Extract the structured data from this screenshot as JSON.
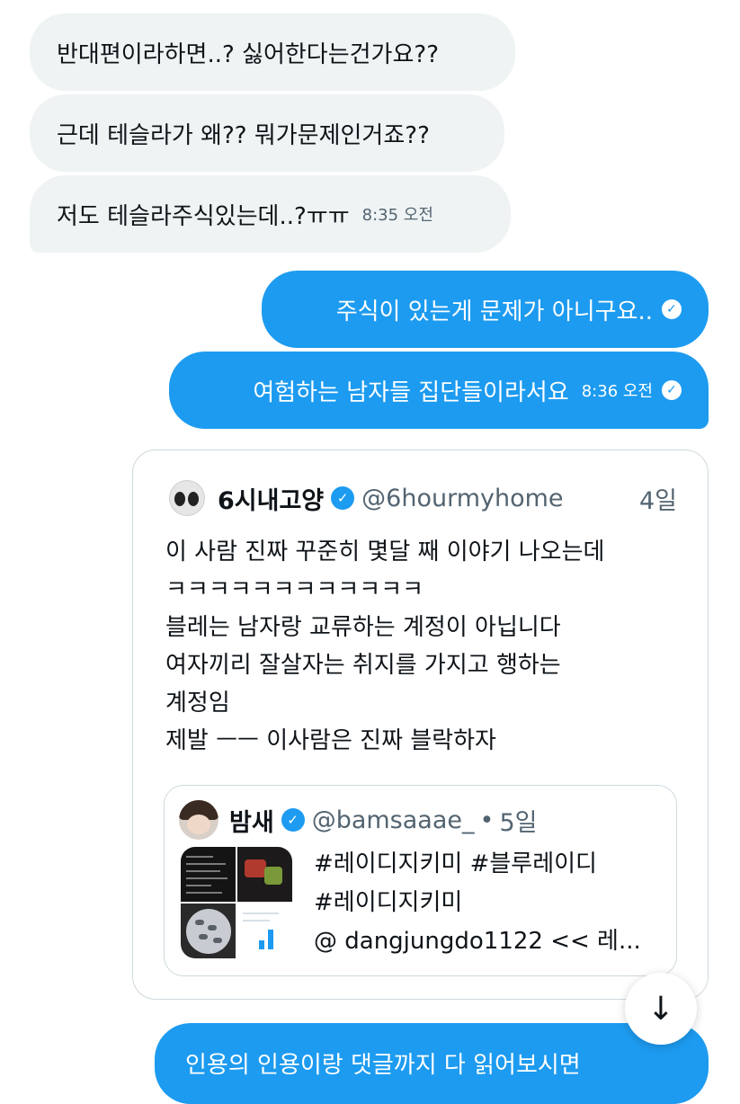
{
  "messages": {
    "received": [
      {
        "text": "반대편이라하면..? 싫어한다는건가요??"
      },
      {
        "text": "근데 테슬라가 왜?? 뭐가문제인거죠??"
      },
      {
        "text": "저도 테슬라주식있는데..?ㅠㅠ",
        "time": "8:35 오전"
      }
    ],
    "sent": [
      {
        "text": "주식이 있는게 문제가 아니구요.."
      },
      {
        "text": "여험하는 남자들 집단들이라서요",
        "time": "8:36 오전"
      }
    ],
    "last_sent": {
      "text": "인용의 인용이랑 댓글까지 다 읽어보시면"
    }
  },
  "quote": {
    "name": "6시내고양",
    "handle": "@6hourmyhome",
    "age": "4일",
    "lines": [
      "이 사람 진짜 꾸준히 몇달 째 이야기 나오는데",
      "ㅋㅋㅋㅋㅋㅋㅋㅋㅋㅋㅋㅋ",
      "블레는 남자랑 교류하는 계정이 아닙니다",
      "여자끼리 잘살자는 취지를 가지고 행하는",
      "계정임",
      "제발 ㅡㅡ 이사람은 진짜 블락하자"
    ],
    "inner": {
      "name": "밤새",
      "handle": "@bamsaaae_",
      "dot": "•",
      "age": "5일",
      "lines": [
        "#레이디지키미 #블루레이디",
        "#레이디지키미",
        "@ dangjungdo1122 << 레..."
      ]
    }
  },
  "icons": {
    "verified": "verified-badge-icon",
    "check": "read-check-icon",
    "scroll": "arrow-down-icon"
  },
  "colors": {
    "accent": "#1d9bf0",
    "received_bg": "#eff3f4",
    "secondary_text": "#536471",
    "border": "#cfd9de"
  }
}
